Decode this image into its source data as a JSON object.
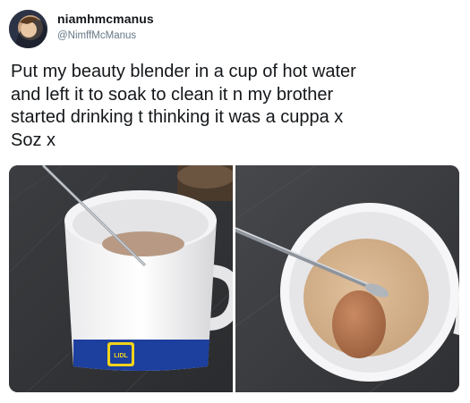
{
  "tweet": {
    "display_name": "niamhmcmanus",
    "handle": "@NimffMcManus",
    "text": "Put my beauty blender in a cup of hot water\nand left it to soak to clean it n my brother\nstarted drinking t thinking it was a cuppa x\nSoz x"
  },
  "media": {
    "photo_count": 2,
    "photos": [
      {
        "description_icon": "mug-with-spoon-photo",
        "brand_logo_text": "LIDL"
      },
      {
        "description_icon": "mug-top-view-photo"
      }
    ]
  },
  "colors": {
    "text_primary": "#14171a",
    "text_secondary": "#657786",
    "mug_band": "#1d3f9e",
    "logo_yellow": "#f2d41a"
  }
}
